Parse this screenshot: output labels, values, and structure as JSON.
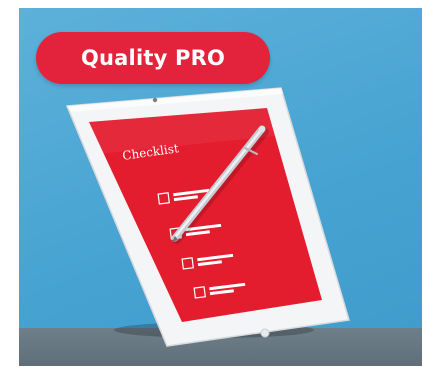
{
  "badge": {
    "label": "Quality PRO"
  },
  "tablet": {
    "screen_title": "Checklist",
    "checklist_items": [
      {
        "checked": false
      },
      {
        "checked": true
      },
      {
        "checked": false
      },
      {
        "checked": false
      }
    ]
  },
  "colors": {
    "badge": "#e3223b",
    "screen": "#e31c2e",
    "background": "#4aa6d4",
    "floor": "#66767f"
  },
  "icons": [
    "pen-icon",
    "checkbox-icon"
  ]
}
